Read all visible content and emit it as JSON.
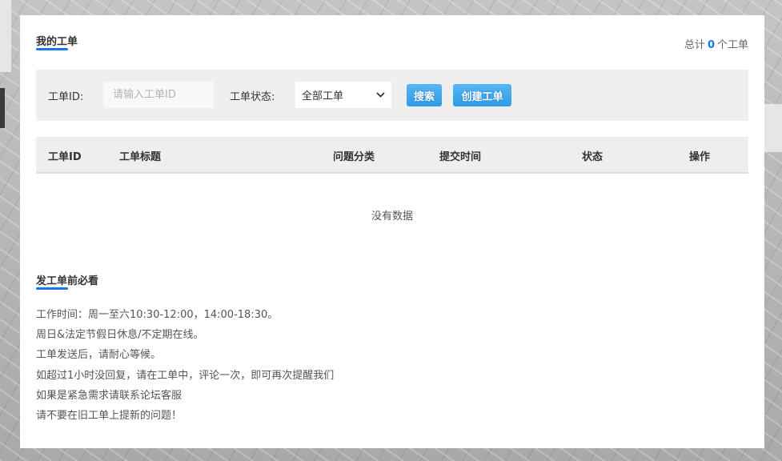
{
  "header": {
    "title": "我的工单",
    "total_prefix": "总计",
    "total_count": "0",
    "total_suffix": "个工单"
  },
  "filters": {
    "id_label": "工单ID:",
    "id_placeholder": "请输入工单ID",
    "status_label": "工单状态:",
    "status_value": "全部工单",
    "search_button": "搜索",
    "create_button": "创建工单"
  },
  "table": {
    "columns": [
      "工单ID",
      "工单标题",
      "问题分类",
      "提交时间",
      "状态",
      "操作"
    ],
    "empty_text": "没有数据"
  },
  "notice": {
    "title": "发工单前必看",
    "lines": [
      "工作时间：周一至六10:30-12:00，14:00-18:30。",
      "周日&法定节假日休息/不定期在线。",
      "工单发送后，请耐心等候。",
      "如超过1小时没回复，请在工单中，评论一次，即可再次提醒我们",
      "如果是紧急需求请联系论坛客服",
      "请不要在旧工单上提新的问题！"
    ]
  },
  "colors": {
    "accent": "#1677e6",
    "button": "#2f9be6",
    "panel": "#efefef"
  }
}
